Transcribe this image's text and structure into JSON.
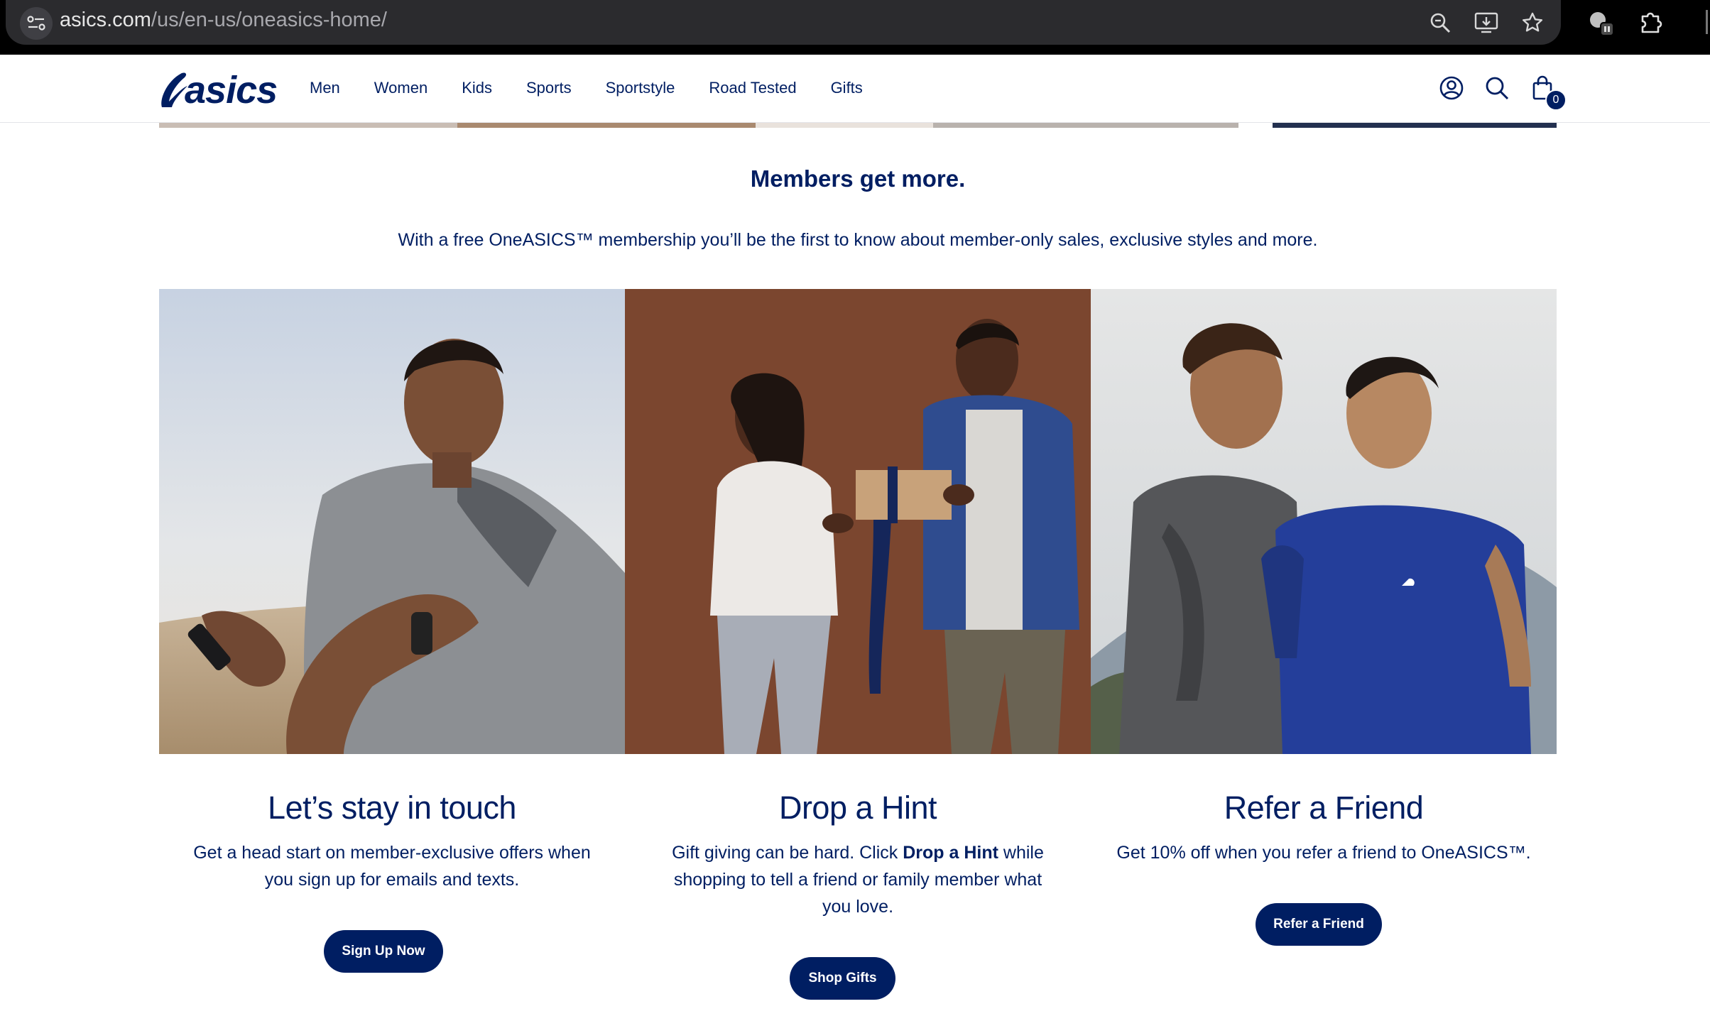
{
  "browser": {
    "url_host": "asics.com",
    "url_path": "/us/en-us/oneasics-home/"
  },
  "header": {
    "logo_text": "asics",
    "nav": [
      "Men",
      "Women",
      "Kids",
      "Sports",
      "Sportstyle",
      "Road Tested",
      "Gifts"
    ],
    "cart_count": "0"
  },
  "members": {
    "title": "Members get more.",
    "description": "With a free OneASICS™ membership you’ll be the first to know about member-only sales, exclusive styles and more."
  },
  "cards": [
    {
      "title": "Let’s stay in touch",
      "text": "Get a head start on member-exclusive offers when you sign up for emails and texts.",
      "button": "Sign Up Now"
    },
    {
      "title": "Drop a Hint",
      "text_before": "Gift giving can be hard. Click ",
      "text_bold": "Drop a Hint",
      "text_after": " while shopping to tell a friend or family member what you love.",
      "button": "Shop Gifts"
    },
    {
      "title": "Refer a Friend",
      "text": "Get 10% off when you refer a friend to OneASICS™.",
      "button": "Refer a Friend"
    }
  ],
  "icons": [
    "site-info-icon",
    "zoom-icon",
    "install-icon",
    "bookmark-star-icon",
    "incognito-icon",
    "extensions-icon",
    "account-icon",
    "search-icon",
    "cart-icon"
  ],
  "colors": {
    "brand_navy": "#001e62",
    "browser_bg": "#000000",
    "urlbar_bg": "#2b2b2e"
  }
}
